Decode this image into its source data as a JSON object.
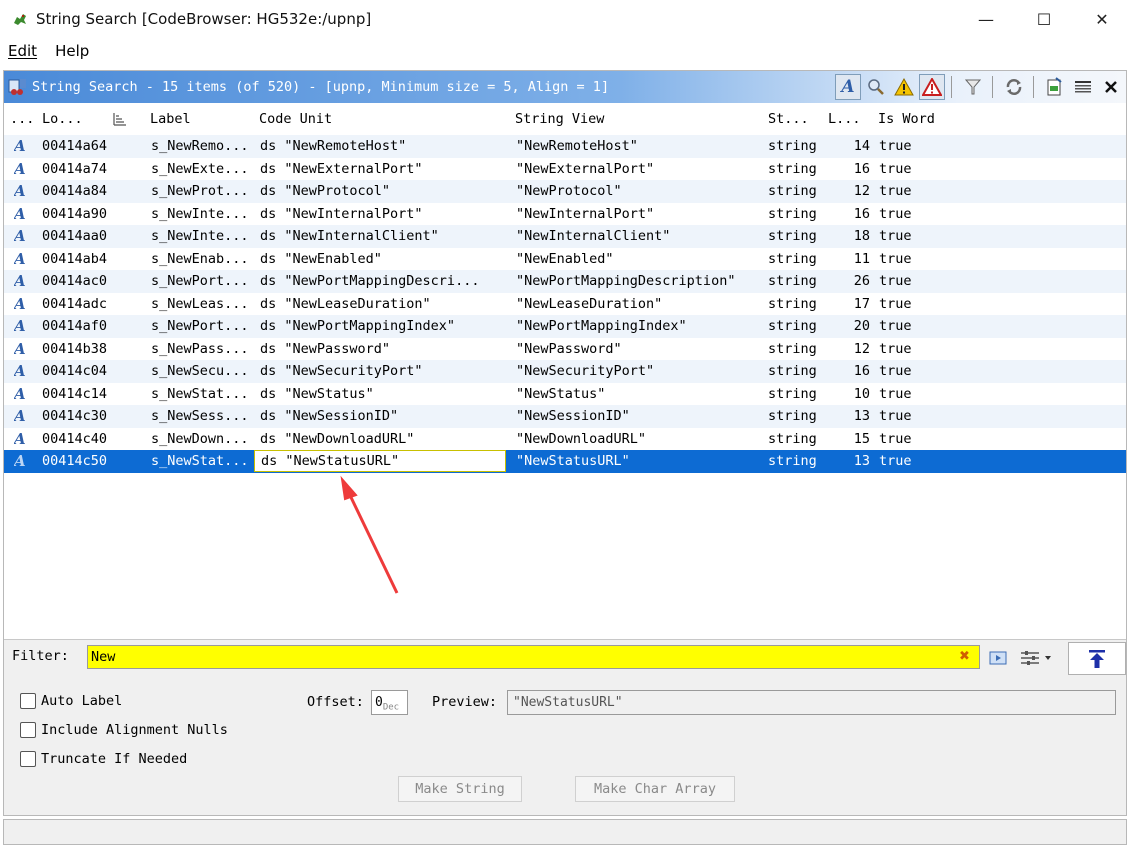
{
  "window": {
    "title": "String Search [CodeBrowser: HG532e:/upnp]",
    "minimize": "—",
    "maximize": "☐",
    "close": "✕"
  },
  "menu": {
    "edit": "Edit",
    "help": "Help"
  },
  "component": {
    "title": "String Search - 15 items (of 520) - [upnp, Minimum size = 5, Align = 1]"
  },
  "table": {
    "columns": [
      "...",
      "Lo...",
      "Label",
      "Code Unit",
      "String View",
      "St...",
      "L...",
      "Is Word"
    ],
    "rows": [
      {
        "loc": "00414a64",
        "label": "s_NewRemo...",
        "code": "ds \"NewRemoteHost\"",
        "view": "\"NewRemoteHost\"",
        "type": "string",
        "len": "14",
        "word": "true"
      },
      {
        "loc": "00414a74",
        "label": "s_NewExte...",
        "code": "ds \"NewExternalPort\"",
        "view": "\"NewExternalPort\"",
        "type": "string",
        "len": "16",
        "word": "true"
      },
      {
        "loc": "00414a84",
        "label": "s_NewProt...",
        "code": "ds \"NewProtocol\"",
        "view": "\"NewProtocol\"",
        "type": "string",
        "len": "12",
        "word": "true"
      },
      {
        "loc": "00414a90",
        "label": "s_NewInte...",
        "code": "ds \"NewInternalPort\"",
        "view": "\"NewInternalPort\"",
        "type": "string",
        "len": "16",
        "word": "true"
      },
      {
        "loc": "00414aa0",
        "label": "s_NewInte...",
        "code": "ds \"NewInternalClient\"",
        "view": "\"NewInternalClient\"",
        "type": "string",
        "len": "18",
        "word": "true"
      },
      {
        "loc": "00414ab4",
        "label": "s_NewEnab...",
        "code": "ds \"NewEnabled\"",
        "view": "\"NewEnabled\"",
        "type": "string",
        "len": "11",
        "word": "true"
      },
      {
        "loc": "00414ac0",
        "label": "s_NewPort...",
        "code": "ds \"NewPortMappingDescri...",
        "view": "\"NewPortMappingDescription\"",
        "type": "string",
        "len": "26",
        "word": "true"
      },
      {
        "loc": "00414adc",
        "label": "s_NewLeas...",
        "code": "ds \"NewLeaseDuration\"",
        "view": "\"NewLeaseDuration\"",
        "type": "string",
        "len": "17",
        "word": "true"
      },
      {
        "loc": "00414af0",
        "label": "s_NewPort...",
        "code": "ds \"NewPortMappingIndex\"",
        "view": "\"NewPortMappingIndex\"",
        "type": "string",
        "len": "20",
        "word": "true"
      },
      {
        "loc": "00414b38",
        "label": "s_NewPass...",
        "code": "ds \"NewPassword\"",
        "view": "\"NewPassword\"",
        "type": "string",
        "len": "12",
        "word": "true"
      },
      {
        "loc": "00414c04",
        "label": "s_NewSecu...",
        "code": "ds \"NewSecurityPort\"",
        "view": "\"NewSecurityPort\"",
        "type": "string",
        "len": "16",
        "word": "true"
      },
      {
        "loc": "00414c14",
        "label": "s_NewStat...",
        "code": "ds \"NewStatus\"",
        "view": "\"NewStatus\"",
        "type": "string",
        "len": "10",
        "word": "true"
      },
      {
        "loc": "00414c30",
        "label": "s_NewSess...",
        "code": "ds \"NewSessionID\"",
        "view": "\"NewSessionID\"",
        "type": "string",
        "len": "13",
        "word": "true"
      },
      {
        "loc": "00414c40",
        "label": "s_NewDown...",
        "code": "ds \"NewDownloadURL\"",
        "view": "\"NewDownloadURL\"",
        "type": "string",
        "len": "15",
        "word": "true"
      },
      {
        "loc": "00414c50",
        "label": "s_NewStat...",
        "code": "ds \"NewStatusURL\"",
        "view": "\"NewStatusURL\"",
        "type": "string",
        "len": "13",
        "word": "true"
      }
    ],
    "selected_index": 14,
    "row_icon": "A"
  },
  "filter": {
    "label": "Filter:",
    "value": "New",
    "highlight_color": "#ffff00"
  },
  "options": {
    "auto_label": "Auto Label",
    "include_alignment_nulls": "Include Alignment Nulls",
    "truncate_if_needed": "Truncate If Needed",
    "offset_label": "Offset:",
    "offset_value": "0",
    "offset_unit": "Dec",
    "preview_label": "Preview:",
    "preview_value": "\"NewStatusURL\"",
    "make_string": "Make String",
    "make_char_array": "Make Char Array"
  },
  "colors": {
    "selection": "#0d6bd3",
    "header_gradient_start": "#4a8ad8",
    "annotation_arrow": "#ee3b3b"
  }
}
